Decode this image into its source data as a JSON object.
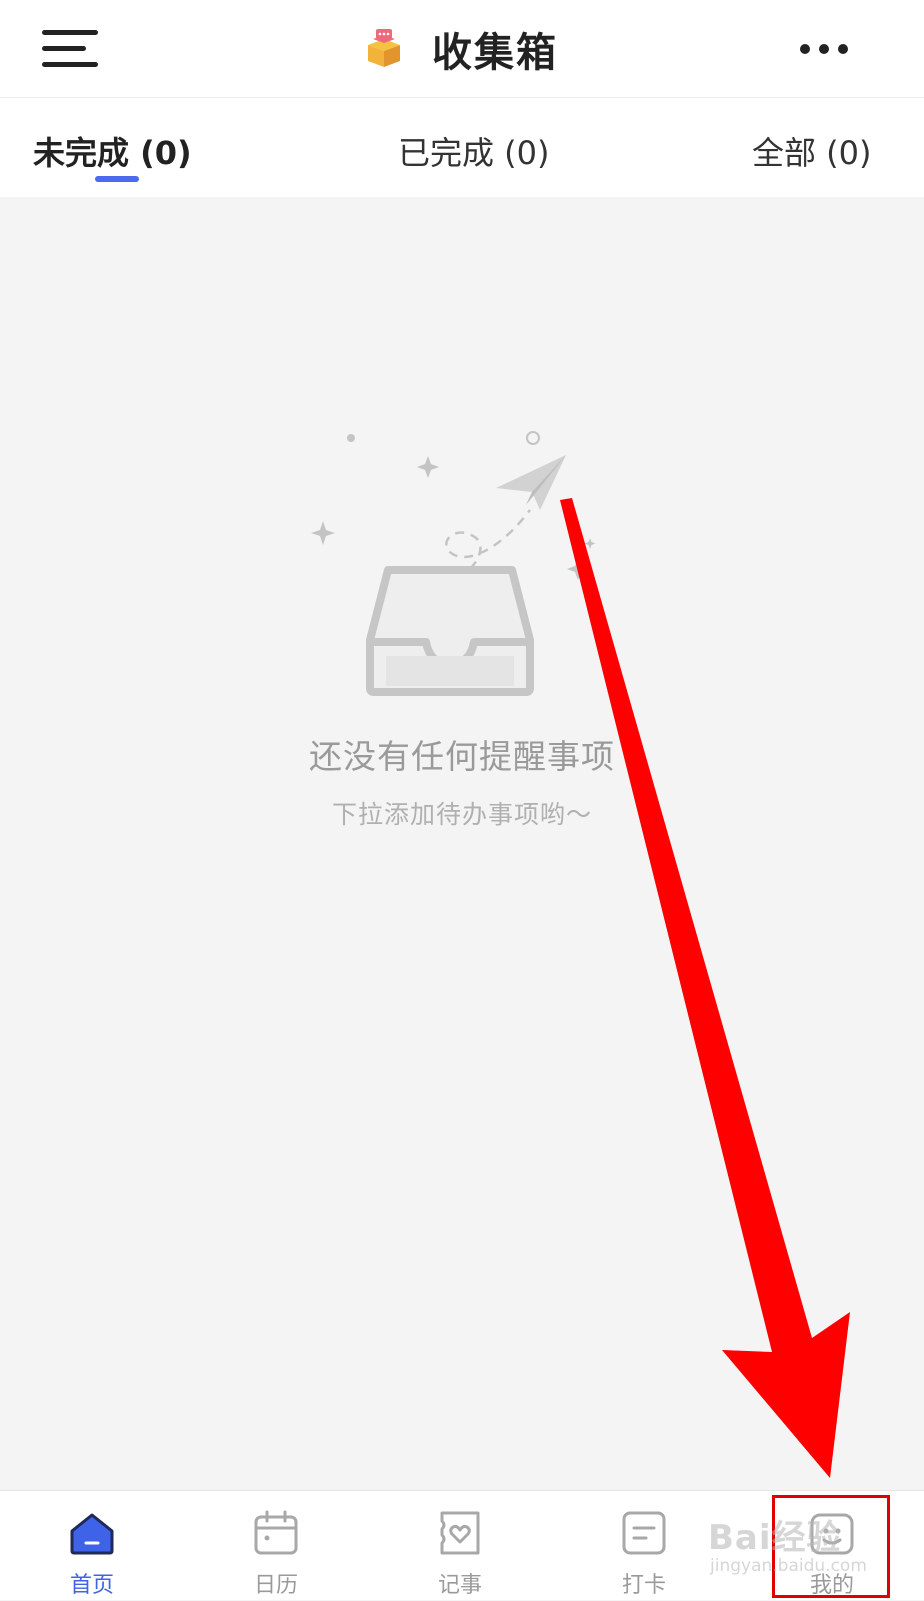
{
  "header": {
    "title": "收集箱",
    "menu_icon": "hamburger-menu-icon",
    "title_icon": "box-icon",
    "more_icon": "more-dots-icon"
  },
  "tabs": [
    {
      "label": "未完成 (0)",
      "active": true
    },
    {
      "label": "已完成 (0)",
      "active": false
    },
    {
      "label": "全部 (0)",
      "active": false
    }
  ],
  "empty_state": {
    "title": "还没有任何提醒事项",
    "subtitle": "下拉添加待办事项哟～",
    "icon": "empty-inbox-paper-plane-icon"
  },
  "bottom_nav": [
    {
      "label": "首页",
      "icon": "home-icon",
      "active": true
    },
    {
      "label": "日历",
      "icon": "calendar-icon",
      "active": false
    },
    {
      "label": "记事",
      "icon": "notes-heart-icon",
      "active": false
    },
    {
      "label": "打卡",
      "icon": "checkin-icon",
      "active": false
    },
    {
      "label": "我的",
      "icon": "profile-icon",
      "active": false
    }
  ],
  "watermark": {
    "main": "Bai经验",
    "sub": "jingyan.baidu.com"
  },
  "colors": {
    "accent": "#4a6bf0",
    "nav_active": "#3f63e8",
    "background": "#f4f4f4",
    "annotation": "#ff0000"
  }
}
